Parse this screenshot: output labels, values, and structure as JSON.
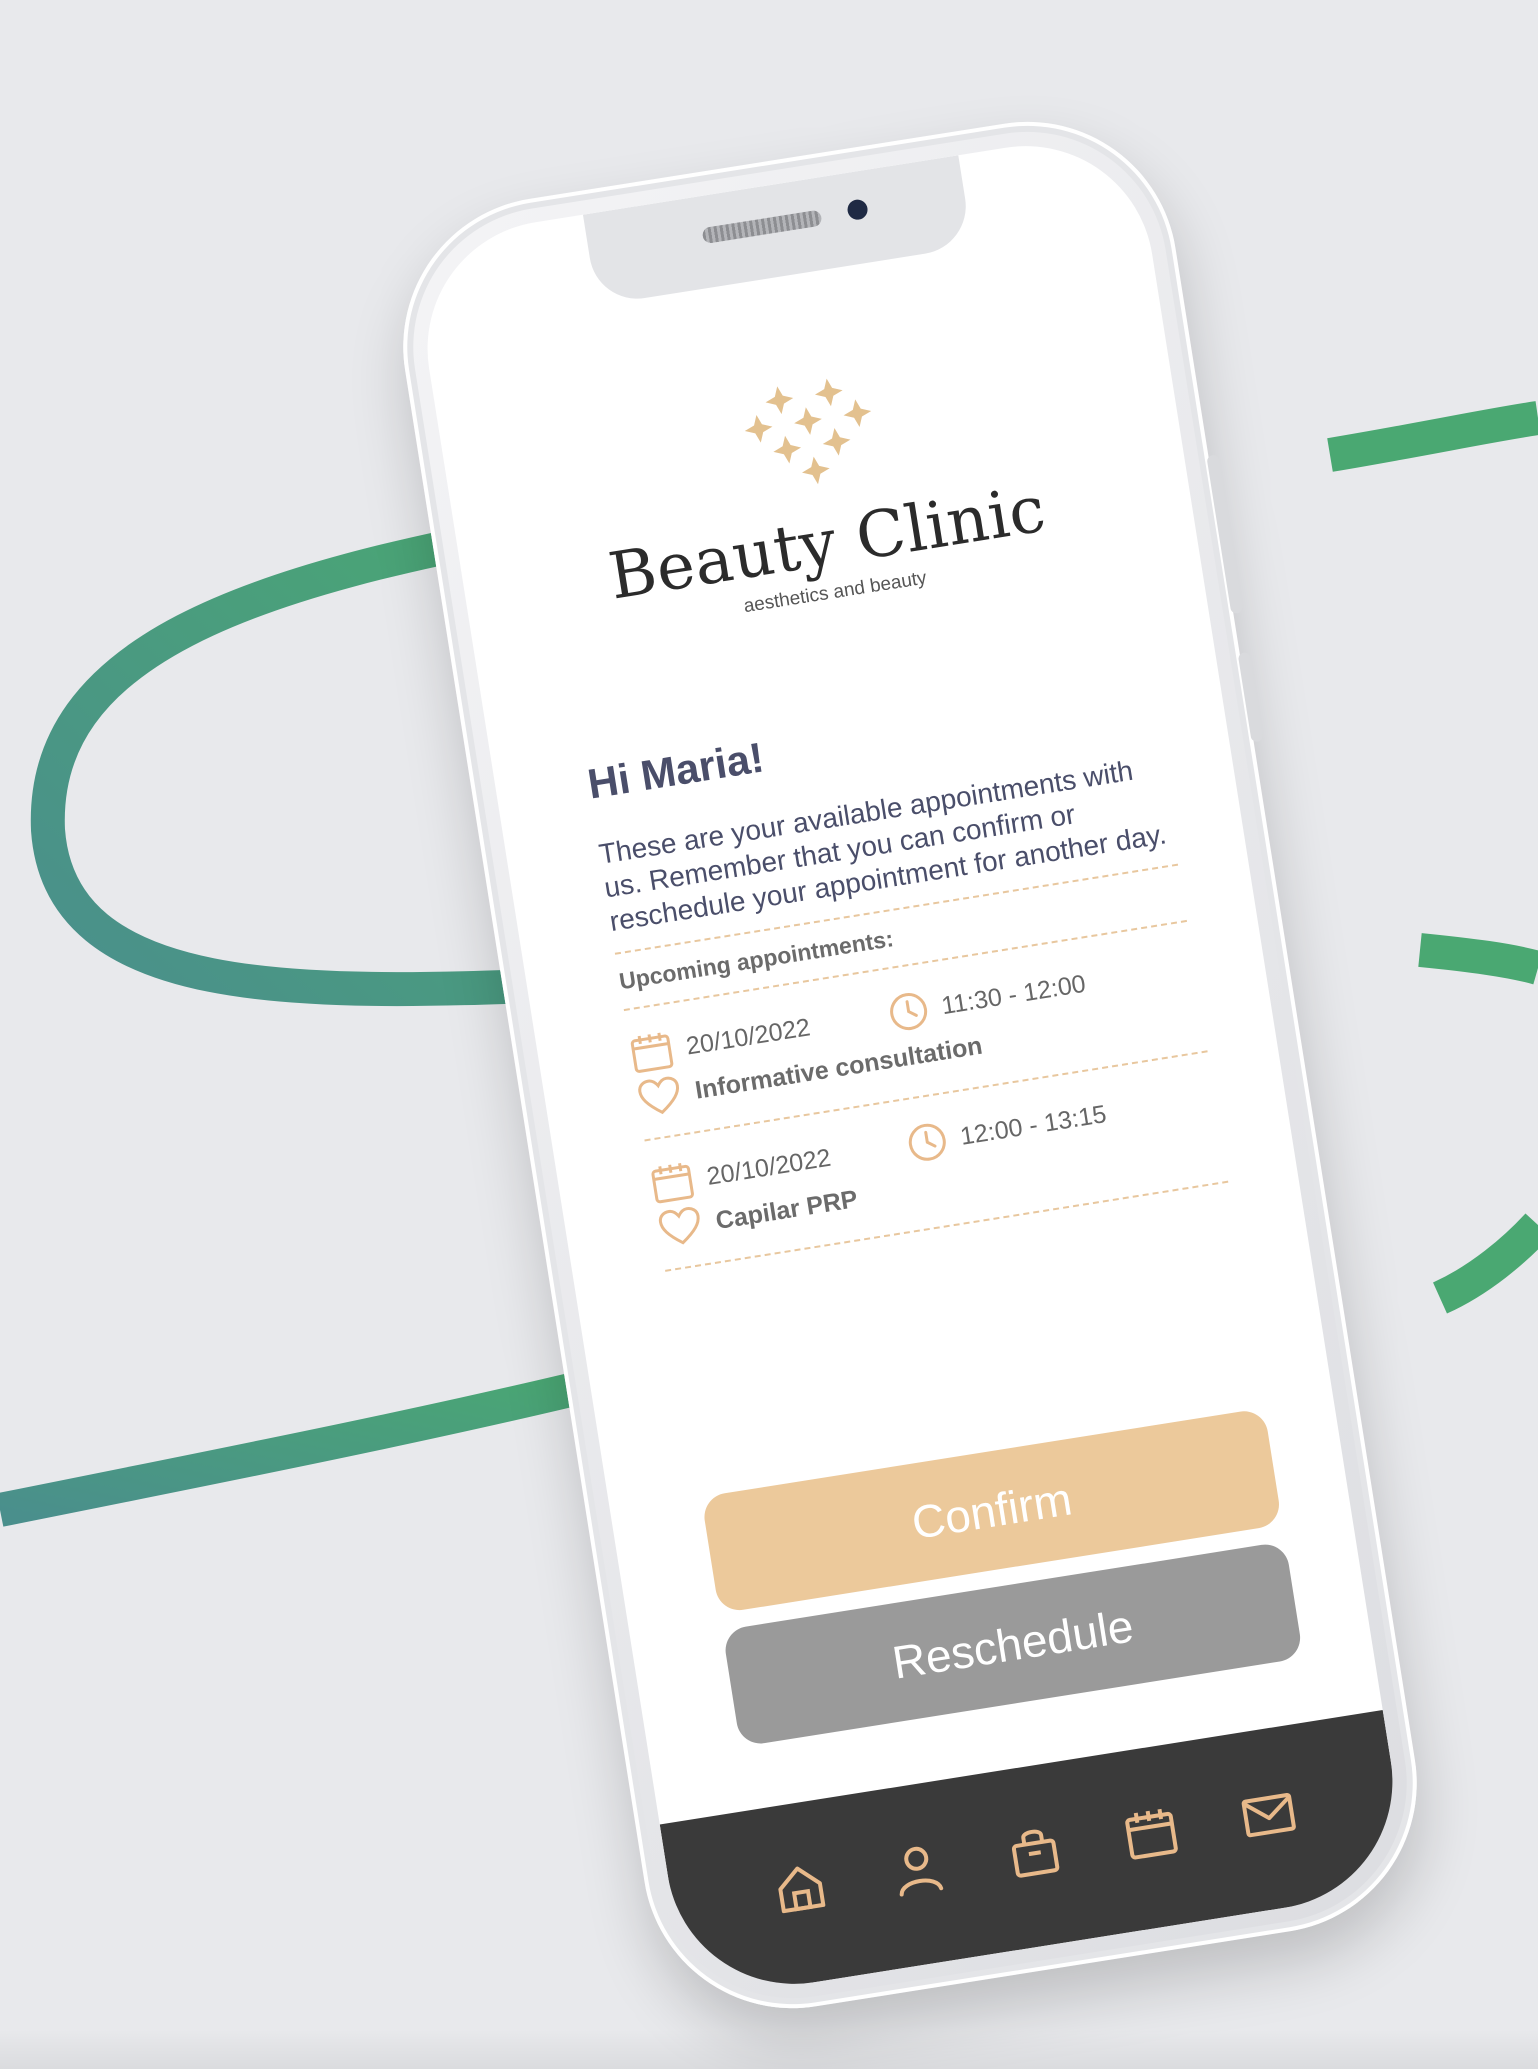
{
  "brand": {
    "name": "Beauty Clinic",
    "tagline": "aesthetics and beauty"
  },
  "greeting": "Hi Maria!",
  "intro": "These are your available appointments with us. Remember that you can confirm or reschedule your appointment for another day.",
  "upcoming_title": "Upcoming appointments:",
  "appointments": [
    {
      "date": "20/10/2022",
      "time": "11:30 - 12:00",
      "service": "Informative consultation"
    },
    {
      "date": "20/10/2022",
      "time": "12:00 - 13:15",
      "service": "Capilar PRP"
    }
  ],
  "buttons": {
    "confirm": "Confirm",
    "reschedule": "Reschedule"
  },
  "tabbar": [
    "home-icon",
    "profile-icon",
    "shop-bag-icon",
    "calendar-icon",
    "mail-icon"
  ],
  "colors": {
    "accent_gold": "#ecc99b",
    "gray_button": "#9a9a9a",
    "tabbar_bg": "#3a3a3a",
    "text_navy": "#4a4e6a",
    "bg_line_green": "#4ca877"
  }
}
